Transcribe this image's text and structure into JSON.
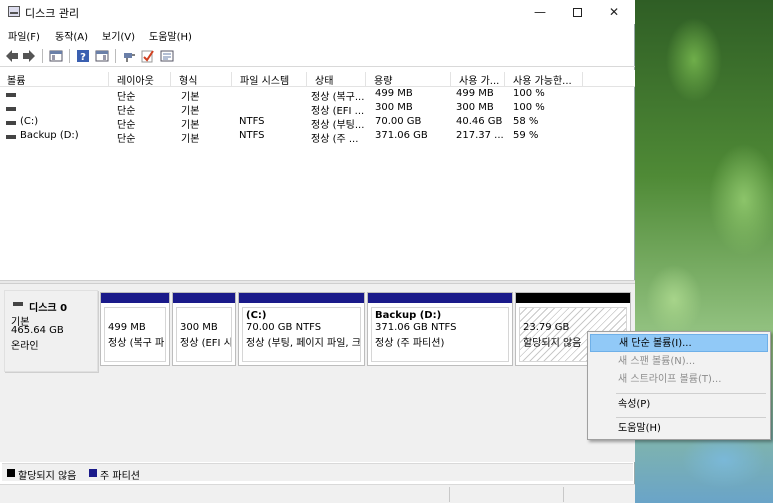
{
  "window": {
    "title": "디스크 관리"
  },
  "menu": [
    "파일(F)",
    "동작(A)",
    "보기(V)",
    "도움말(H)"
  ],
  "toolbar": {
    "icons": [
      "back-arrow-icon",
      "forward-arrow-icon",
      "console-tree-icon",
      "help-icon",
      "disk-list-icon",
      "connect-icon",
      "checkmark-icon",
      "properties-icon"
    ]
  },
  "volume_table": {
    "headers": [
      "볼륨",
      "레이아웃",
      "형식",
      "파일 시스템",
      "상태",
      "용량",
      "사용 가...",
      "사용 가능한..."
    ],
    "rows": [
      {
        "name": "",
        "layout": "단순",
        "type": "기본",
        "fs": "",
        "status": "정상 (복구...",
        "capacity": "499 MB",
        "free": "499 MB",
        "pct": "100 %"
      },
      {
        "name": "",
        "layout": "단순",
        "type": "기본",
        "fs": "",
        "status": "정상 (EFI ...",
        "capacity": "300 MB",
        "free": "300 MB",
        "pct": "100 %"
      },
      {
        "name": "(C:)",
        "layout": "단순",
        "type": "기본",
        "fs": "NTFS",
        "status": "정상 (부팅...",
        "capacity": "70.00 GB",
        "free": "40.46 GB",
        "pct": "58 %"
      },
      {
        "name": "Backup (D:)",
        "layout": "단순",
        "type": "기본",
        "fs": "NTFS",
        "status": "정상 (주 ...",
        "capacity": "371.06 GB",
        "free": "217.37 ...",
        "pct": "59 %"
      }
    ]
  },
  "disk": {
    "title": "디스크 0",
    "type": "기본",
    "size": "465.64 GB",
    "state": "온라인"
  },
  "partitions": [
    {
      "name": "",
      "size": "499 MB",
      "status": "정상 (복구 파",
      "kind": "primary"
    },
    {
      "name": "",
      "size": "300 MB",
      "status": "정상 (EFI 시",
      "kind": "primary"
    },
    {
      "name": "(C:)",
      "size": "70.00 GB NTFS",
      "status": "정상 (부팅, 페이지 파일, 크",
      "kind": "primary"
    },
    {
      "name": "Backup  (D:)",
      "size": "371.06 GB NTFS",
      "status": "정상 (주 파티션)",
      "kind": "primary"
    },
    {
      "name": "",
      "size": "23.79 GB",
      "status": "할당되지 않음",
      "kind": "unallocated"
    }
  ],
  "legend": [
    {
      "label": "할당되지 않음",
      "color": "#000000"
    },
    {
      "label": "주 파티션",
      "color": "#1a1a8a"
    }
  ],
  "context_menu": [
    {
      "label": "새 단순 볼륨(I)...",
      "state": "highlighted"
    },
    {
      "label": "새 스팬 볼륨(N)...",
      "state": "disabled"
    },
    {
      "label": "새 스트라이프 볼륨(T)...",
      "state": "disabled"
    },
    {
      "label": "속성(P)",
      "state": "enabled"
    },
    {
      "label": "도움말(H)",
      "state": "enabled"
    }
  ]
}
